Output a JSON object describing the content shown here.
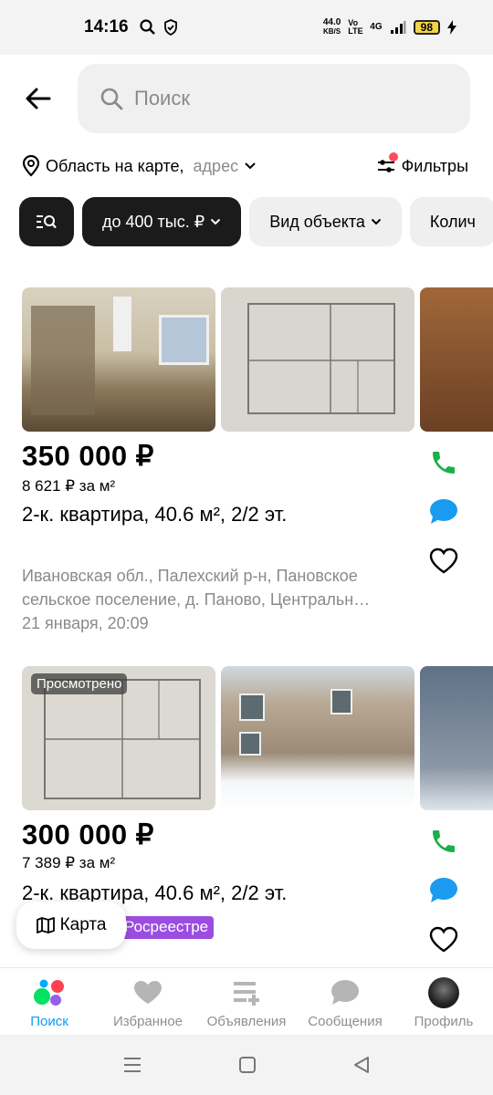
{
  "status": {
    "time": "14:16",
    "netspeed_top": "44.0",
    "netspeed_bottom": "KB/S",
    "volte": "Vo LTE",
    "network": "4G",
    "battery": "98"
  },
  "search": {
    "placeholder": "Поиск"
  },
  "location": {
    "label": "Область на карте,",
    "hint": "адрес",
    "filters_label": "Фильтры"
  },
  "chips": [
    {
      "label": "до 400 тыс. ₽"
    },
    {
      "label": "Вид объекта"
    },
    {
      "label": "Колич"
    }
  ],
  "listings": [
    {
      "price": "350 000 ₽",
      "price_per_m": "8 621 ₽ за м²",
      "title": "2-к. квартира, 40.6 м², 2/2 эт.",
      "address_line1": "Ивановская обл., Палехский р-н, Пановское",
      "address_line2": "сельское поселение, д. Паново, Централь­н…",
      "date": "21 января, 20:09"
    },
    {
      "badge": "Просмотрено",
      "price": "300 000 ₽",
      "price_per_m": "7 389 ₽ за м²",
      "title": "2-к. квартира, 40.6 м², 2/2 эт.",
      "tag": "Росреестре"
    }
  ],
  "map_button": {
    "label": "Карта"
  },
  "tabbar": [
    {
      "label": "Поиск"
    },
    {
      "label": "Избранное"
    },
    {
      "label": "Объявления"
    },
    {
      "label": "Сообщения"
    },
    {
      "label": "Профиль"
    }
  ],
  "colors": {
    "accent": "#0a9ef5",
    "phone_green": "#19b04a",
    "chat_blue": "#1a9bf0",
    "tag_purple": "#9b4de0"
  }
}
